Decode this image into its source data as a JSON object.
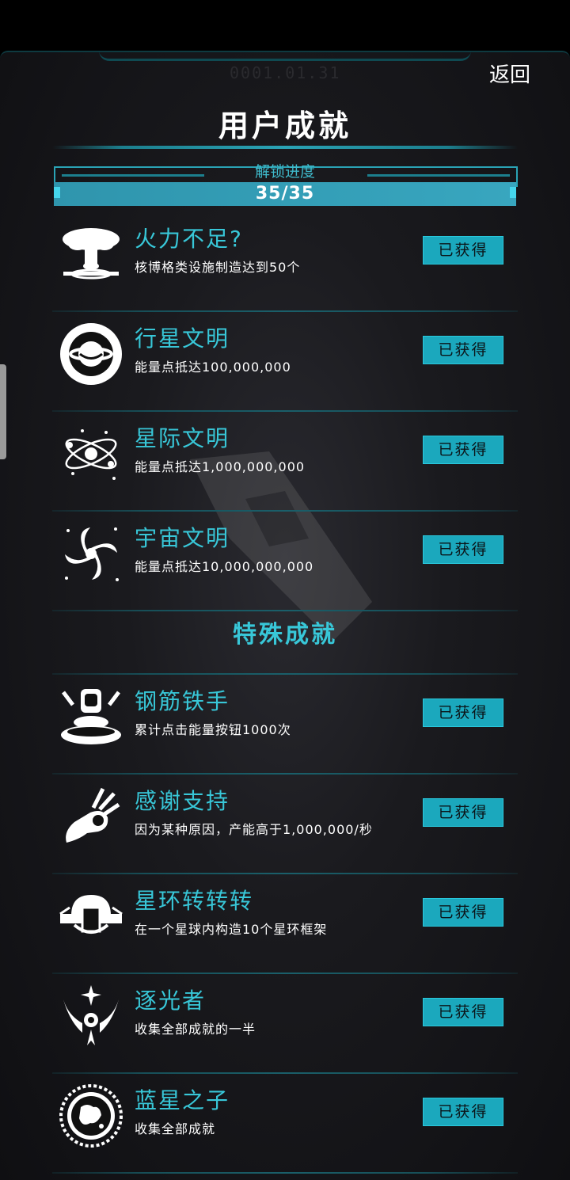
{
  "header": {
    "date": "0001.01.31",
    "back_label": "返回",
    "title": "用户成就"
  },
  "progress": {
    "label": "解锁进度",
    "text": "35/35",
    "fraction": 1.0
  },
  "achievements": [
    {
      "name": "火力不足?",
      "desc": "核博格类设施制造达到50个",
      "status": "已获得",
      "icon": "mushroom-cloud-icon"
    },
    {
      "name": "行星文明",
      "desc": "能量点抵达100,000,000",
      "status": "已获得",
      "icon": "planet-civilization-icon"
    },
    {
      "name": "星际文明",
      "desc": "能量点抵达1,000,000,000",
      "status": "已获得",
      "icon": "interstellar-icon"
    },
    {
      "name": "宇宙文明",
      "desc": "能量点抵达10,000,000,000",
      "status": "已获得",
      "icon": "galaxy-swirl-icon"
    }
  ],
  "special": {
    "heading": "特殊成就",
    "items": [
      {
        "name": "钢筋铁手",
        "desc": "累计点击能量按钮1000次",
        "status": "已获得",
        "icon": "press-button-icon"
      },
      {
        "name": "感谢支持",
        "desc": "因为某种原因，产能高于1,000,000/秒",
        "status": "已获得",
        "icon": "ok-hand-icon"
      },
      {
        "name": "星环转转转",
        "desc": "在一个星球内构造10个星环框架",
        "status": "已获得",
        "icon": "star-ring-icon"
      },
      {
        "name": "逐光者",
        "desc": "收集全部成就的一半",
        "status": "已获得",
        "icon": "light-chaser-icon"
      },
      {
        "name": "蓝星之子",
        "desc": "收集全部成就",
        "status": "已获得",
        "icon": "blue-planet-icon"
      }
    ]
  },
  "colors": {
    "accent": "#38c7d8",
    "badge": "#1ba8bd",
    "bar": "#2a8ea6"
  }
}
